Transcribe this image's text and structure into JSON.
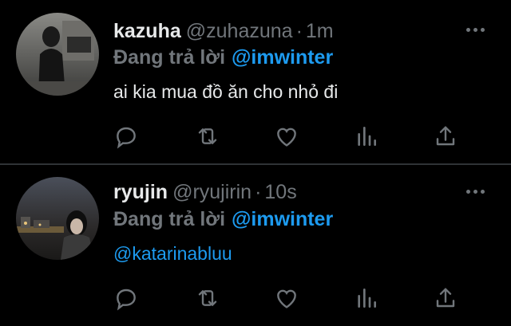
{
  "tweets": [
    {
      "name": "kazuha",
      "handle": "@zuhazuna",
      "separator": "·",
      "time": "1m",
      "reply_prefix": "Đang trả lời",
      "reply_to": "@imwinter",
      "text": "ai kia mua đồ ăn cho nhỏ đi",
      "mention": ""
    },
    {
      "name": "ryujin",
      "handle": "@ryujirin",
      "separator": "·",
      "time": "10s",
      "reply_prefix": "Đang trả lời",
      "reply_to": "@imwinter",
      "text": "",
      "mention": "@katarinabluu"
    }
  ],
  "icons": {
    "reply": "reply-icon",
    "retweet": "retweet-icon",
    "like": "heart-icon",
    "stats": "stats-icon",
    "share": "share-icon",
    "more": "more-icon"
  },
  "colors": {
    "background": "#000000",
    "text": "#e7e9ea",
    "secondary": "#71767b",
    "accent": "#1d9bf0",
    "divider": "#2f3336"
  }
}
